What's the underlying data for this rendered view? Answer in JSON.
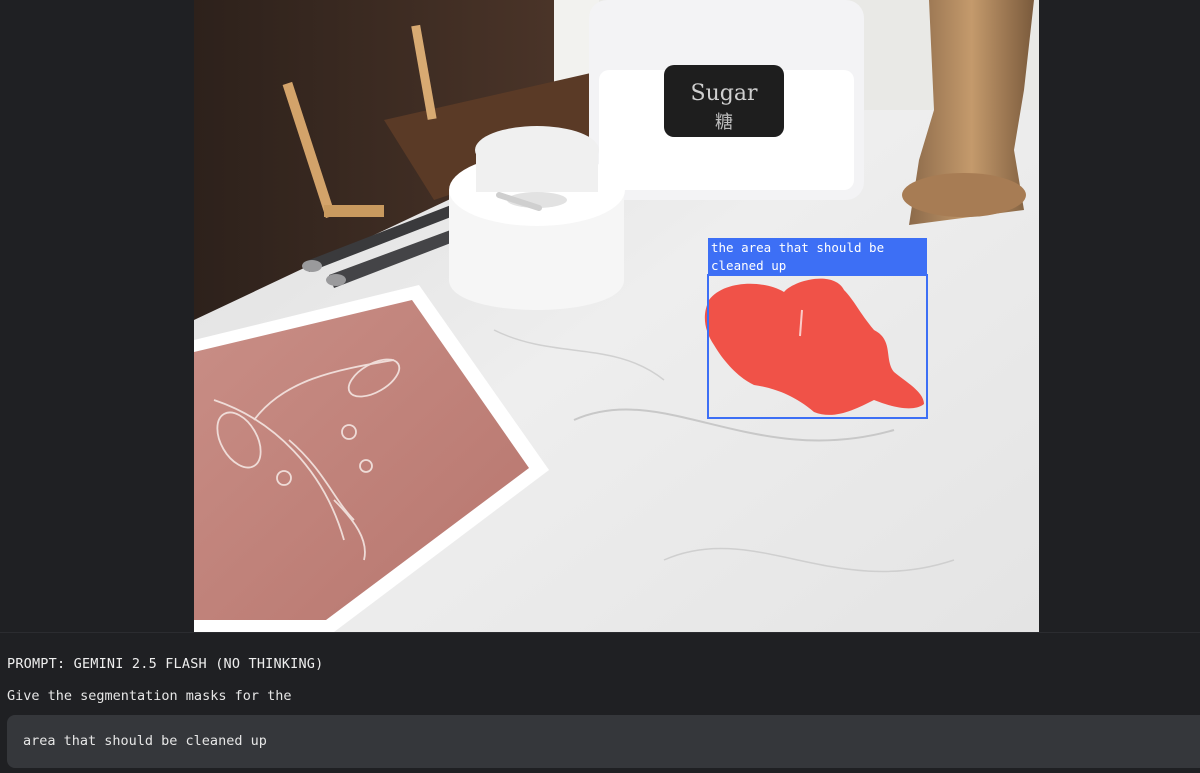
{
  "detection": {
    "label": "the area that should be cleaned up",
    "color": "#3d6ff5"
  },
  "photo": {
    "jar_label": "Sugar",
    "jar_label_cjk": "糖"
  },
  "prompt": {
    "title": "PROMPT: GEMINI 2.5 FLASH (NO THINKING)",
    "line": "Give the segmentation masks for the",
    "query": "area that should be cleaned up"
  },
  "colors": {
    "background": "#1f2023",
    "chip": "#35373b",
    "mask": "#f0443a"
  }
}
